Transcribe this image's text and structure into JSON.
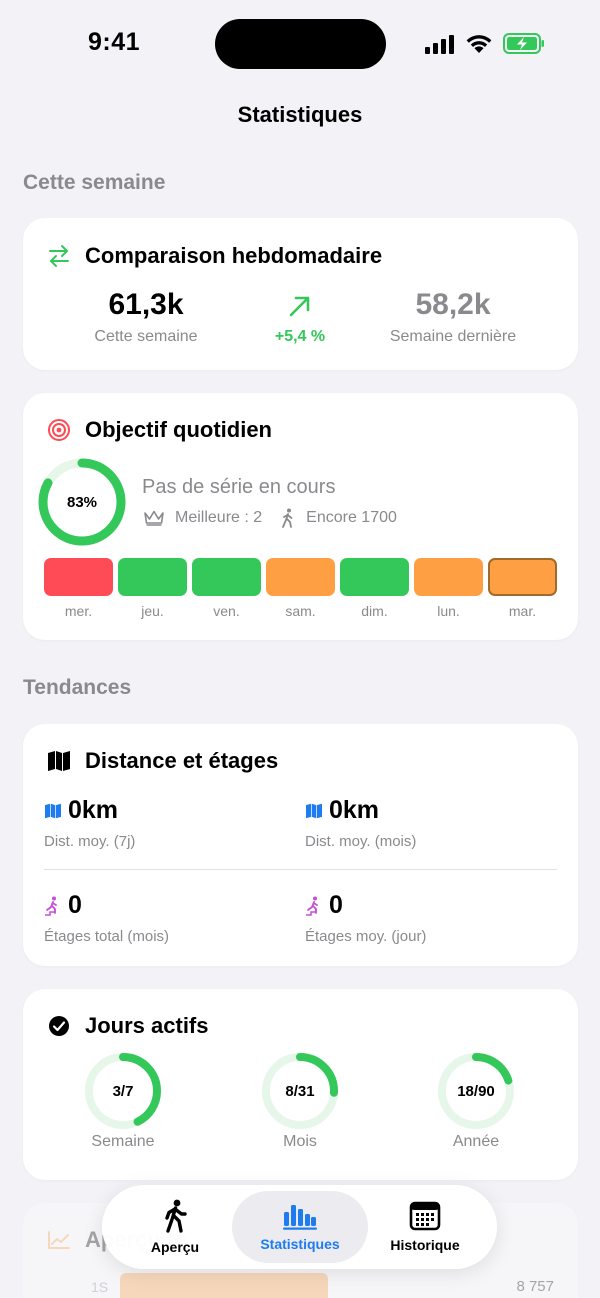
{
  "status": {
    "time": "9:41"
  },
  "nav": {
    "title": "Statistiques"
  },
  "sections": {
    "this_week": "Cette semaine",
    "trends": "Tendances"
  },
  "weekly": {
    "title": "Comparaison hebdomadaire",
    "current_value": "61,3k",
    "current_label": "Cette semaine",
    "change": "+5,4 %",
    "previous_value": "58,2k",
    "previous_label": "Semaine dernière"
  },
  "goal": {
    "title": "Objectif quotidien",
    "percent_text": "83%",
    "percent": 0.83,
    "streak_text": "Pas de série en cours",
    "best": "Meilleure : 2",
    "remaining": "Encore 1700",
    "days": [
      {
        "label": "mer.",
        "status": "red"
      },
      {
        "label": "jeu.",
        "status": "green"
      },
      {
        "label": "ven.",
        "status": "green"
      },
      {
        "label": "sam.",
        "status": "orange"
      },
      {
        "label": "dim.",
        "status": "green"
      },
      {
        "label": "lun.",
        "status": "orange"
      },
      {
        "label": "mar.",
        "status": "orange-today"
      }
    ]
  },
  "distance": {
    "title": "Distance et étages",
    "avg_7d_value": "0km",
    "avg_7d_label": "Dist. moy. (7j)",
    "avg_month_value": "0km",
    "avg_month_label": "Dist. moy. (mois)",
    "floors_total_value": "0",
    "floors_total_label": "Étages total (mois)",
    "floors_avg_value": "0",
    "floors_avg_label": "Étages moy. (jour)"
  },
  "active_days": {
    "title": "Jours actifs",
    "items": [
      {
        "value": "3/7",
        "fraction": 0.4286,
        "label": "Semaine"
      },
      {
        "value": "8/31",
        "fraction": 0.258,
        "label": "Mois"
      },
      {
        "value": "18/90",
        "fraction": 0.2,
        "label": "Année"
      }
    ]
  },
  "overview": {
    "title": "Aperçu te",
    "row_label": "1S",
    "row_value": "8 757"
  },
  "tabs": [
    {
      "label": "Aperçu",
      "icon": "walking-person-icon"
    },
    {
      "label": "Statistiques",
      "icon": "bar-chart-icon"
    },
    {
      "label": "Historique",
      "icon": "calendar-icon"
    }
  ],
  "colors": {
    "green": "#34c759",
    "green_light": "#e6f7ea",
    "orange": "#ff9f43",
    "red": "#ff4b55",
    "accent": "#1e7cf0",
    "floors_purple": "#c64fd8"
  }
}
